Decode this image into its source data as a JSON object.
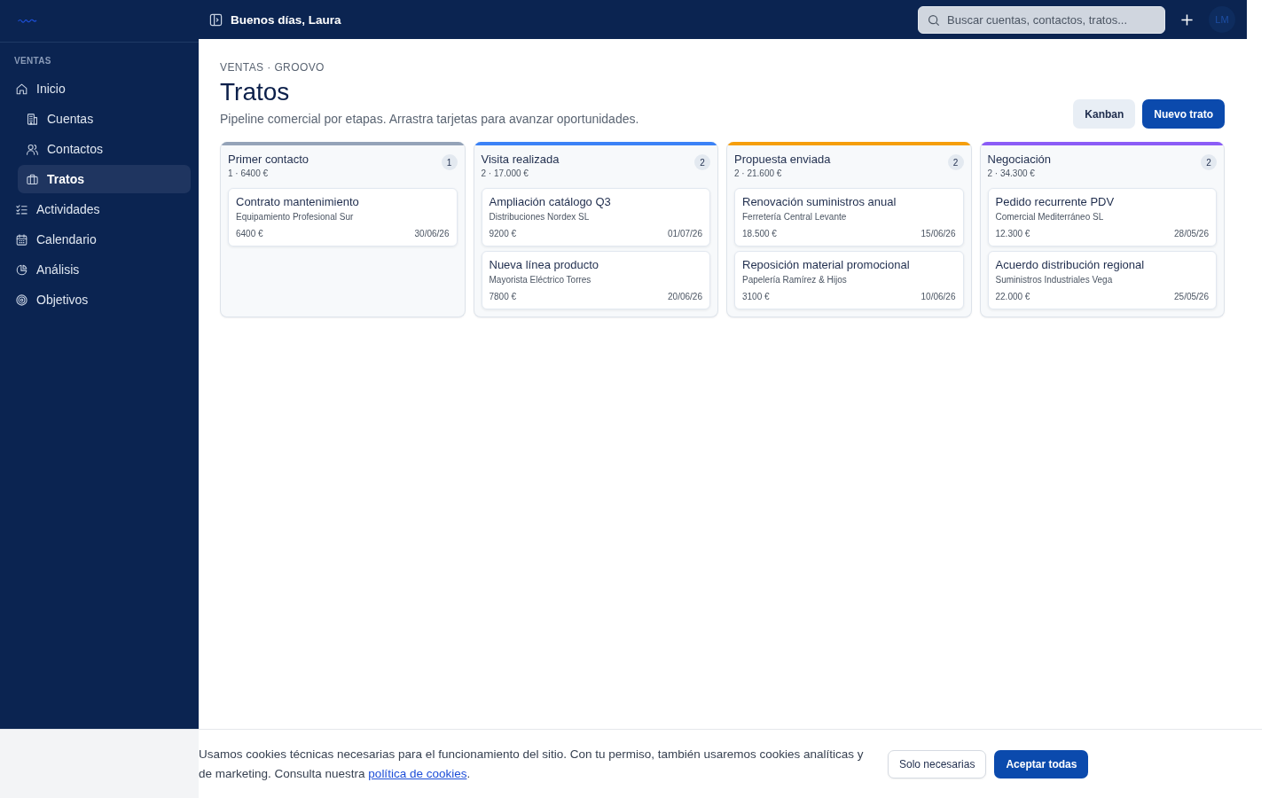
{
  "sidebar": {
    "section_label": "VENTAS",
    "items": [
      {
        "label": "Inicio",
        "selected": false,
        "children": [
          {
            "label": "Cuentas",
            "selected": false
          },
          {
            "label": "Contactos",
            "selected": false
          },
          {
            "label": "Tratos",
            "selected": true
          }
        ]
      },
      {
        "label": "Actividades",
        "selected": false
      },
      {
        "label": "Calendario",
        "selected": false
      },
      {
        "label": "Análisis",
        "selected": false
      },
      {
        "label": "Objetivos",
        "selected": false
      }
    ]
  },
  "topbar": {
    "greeting": "Buenos días, Laura",
    "search": {
      "placeholder": "Buscar cuentas, contactos, tratos..."
    },
    "avatar": "LM"
  },
  "page": {
    "breadcrumb": "VENTAS · GROOVO",
    "title": "Tratos",
    "subtitle": "Pipeline comercial por etapas. Arrastra tarjetas para avanzar oportunidades.",
    "buttons": [
      {
        "label": "Kanban",
        "kind": "secondary"
      },
      {
        "label": "Nuevo trato",
        "kind": "primary"
      }
    ]
  },
  "board": {
    "columns": [
      {
        "title": "Primer contacto",
        "summary": "1 · 6400 €",
        "count": "1",
        "color": "#94a3b8",
        "cards": [
          {
            "title": "Contrato mantenimiento",
            "company": "Equipamiento Profesional Sur",
            "amount": "6400 €",
            "date": "30/06/26"
          }
        ]
      },
      {
        "title": "Visita realizada",
        "summary": "2 · 17.000 €",
        "count": "2",
        "color": "#3b82f6",
        "cards": [
          {
            "title": "Ampliación catálogo Q3",
            "company": "Distribuciones Nordex SL",
            "amount": "9200 €",
            "date": "01/07/26"
          },
          {
            "title": "Nueva línea producto",
            "company": "Mayorista Eléctrico Torres",
            "amount": "7800 €",
            "date": "20/06/26"
          }
        ]
      },
      {
        "title": "Propuesta enviada",
        "summary": "2 · 21.600 €",
        "count": "2",
        "color": "#f59e0b",
        "cards": [
          {
            "title": "Renovación suministros anual",
            "company": "Ferretería Central Levante",
            "amount": "18.500 €",
            "date": "15/06/26"
          },
          {
            "title": "Reposición material promocional",
            "company": "Papelería Ramírez & Hijos",
            "amount": "3100 €",
            "date": "10/06/26"
          }
        ]
      },
      {
        "title": "Negociación",
        "summary": "2 · 34.300 €",
        "count": "2",
        "color": "#8b5cf6",
        "cards": [
          {
            "title": "Pedido recurrente PDV",
            "company": "Comercial Mediterráneo SL",
            "amount": "12.300 €",
            "date": "28/05/26"
          },
          {
            "title": "Acuerdo distribución regional",
            "company": "Suministros Industriales Vega",
            "amount": "22.000 €",
            "date": "25/05/26"
          }
        ]
      }
    ]
  },
  "cookie_banner": {
    "text": "Usamos cookies técnicas necesarias para el funcionamiento del sitio. Con tu permiso, también usaremos cookies analíticas y de marketing. Consulta nuestra",
    "link": "política de cookies",
    "text_end": ".",
    "buttons": [
      {
        "label": "Solo necesarias",
        "kind": "secondary"
      },
      {
        "label": "Aceptar todas",
        "kind": "primary"
      }
    ]
  }
}
